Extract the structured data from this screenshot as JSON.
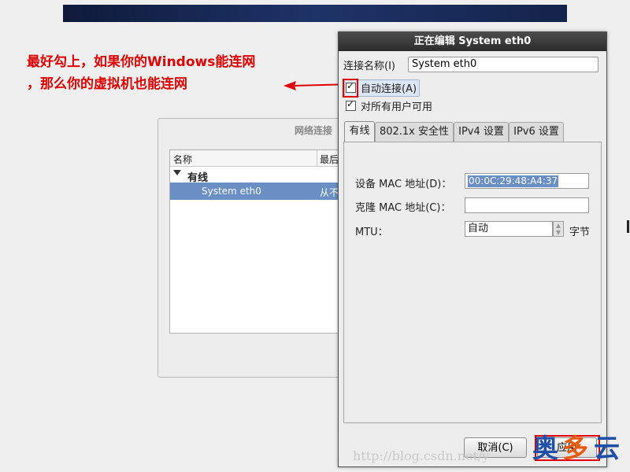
{
  "annotation": {
    "line1": "最好勾上，如果你的Windows能连网",
    "line2": "，那么你的虚拟机也能连网",
    "color": "#e00000"
  },
  "background_window": {
    "title": "网络连接",
    "columns": [
      "名称",
      "最后"
    ],
    "group_label": "有线",
    "row": {
      "name": "System eth0",
      "last_used": "从不"
    }
  },
  "dialog": {
    "title": "正在编辑 System eth0",
    "connection_name_label": "连接名称(I)",
    "connection_name_value": "System eth0",
    "auto_connect_label": "自动连接(A)",
    "auto_connect_checked": true,
    "all_users_label": "对所有用户可用",
    "all_users_checked": true,
    "tabs": [
      "有线",
      "802.1x 安全性",
      "IPv4 设置",
      "IPv6 设置"
    ],
    "active_tab": "有线",
    "wired": {
      "device_mac_label": "设备 MAC 地址(D)：",
      "device_mac_value": "00:0C:29:48:A4:37",
      "cloned_mac_label": "克隆 MAC 地址(C)：",
      "cloned_mac_value": "",
      "mtu_label": "MTU：",
      "mtu_value": "自动",
      "mtu_unit": "字节"
    },
    "buttons": {
      "cancel": "取消(C)",
      "apply": "应用"
    }
  },
  "watermark": {
    "url": "http://blog.csdn.net/y",
    "logo_chars": [
      "奥",
      "多",
      "云"
    ]
  }
}
